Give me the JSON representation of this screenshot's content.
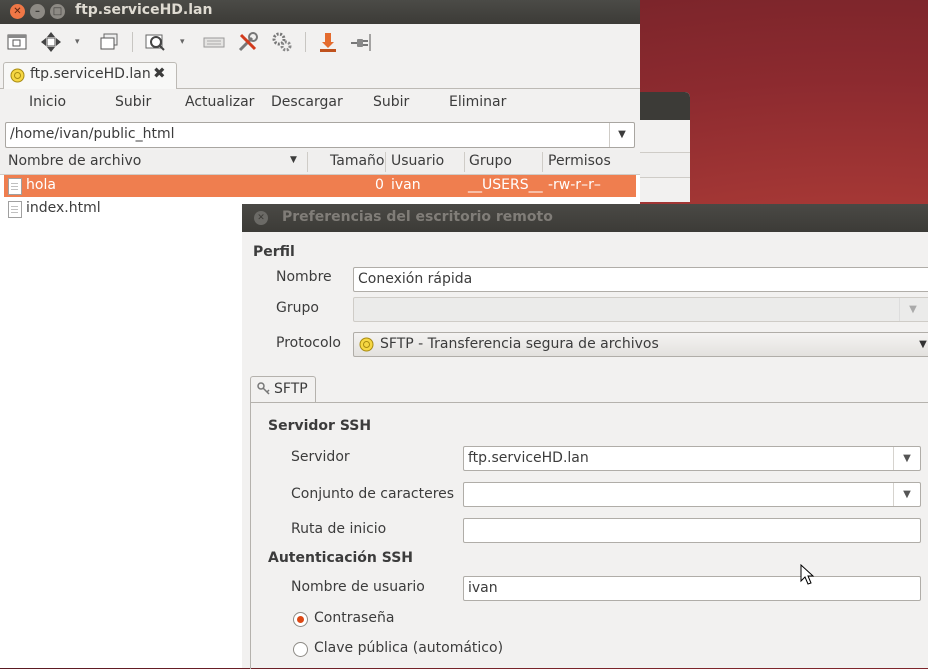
{
  "ftp_window": {
    "title": "ftp.serviceHD.lan",
    "tab_label": "ftp.serviceHD.lan",
    "actions": [
      "Inicio",
      "Subir",
      "Actualizar",
      "Descargar",
      "Subir",
      "Eliminar"
    ],
    "path": "/home/ivan/public_html",
    "columns": {
      "name": "Nombre de archivo",
      "size": "Tamaño",
      "user": "Usuario",
      "group": "Grupo",
      "perms": "Permisos"
    },
    "files": [
      {
        "name": "hola",
        "size": "0",
        "user": "ivan",
        "group": "__USERS__",
        "perms": "-rw-r–r–"
      },
      {
        "name": "index.html",
        "size": "",
        "user": "",
        "group": "",
        "perms": ""
      }
    ]
  },
  "preferences": {
    "title": "Preferencias del escritorio remoto",
    "profile_section": "Perfil",
    "name_label": "Nombre",
    "name_value": "Conexión rápida",
    "group_label": "Grupo",
    "group_value": "",
    "protocol_label": "Protocolo",
    "protocol_value": "SFTP - Transferencia segura de archivos",
    "tab_label": "SFTP",
    "ssh_server_section": "Servidor SSH",
    "server_label": "Servidor",
    "server_value": "ftp.serviceHD.lan",
    "charset_label": "Conjunto de caracteres",
    "charset_value": "",
    "startpath_label": "Ruta de inicio",
    "startpath_value": "",
    "ssh_auth_section": "Autenticación SSH",
    "username_label": "Nombre de usuario",
    "username_value": "ivan",
    "radio_password": "Contraseña",
    "radio_pubkey": "Clave pública (automático)",
    "selected_auth": "password"
  },
  "colors": {
    "selection": "#ef7e4f",
    "titlebar": "#3c3b37",
    "close_orange": "#dd4814"
  }
}
